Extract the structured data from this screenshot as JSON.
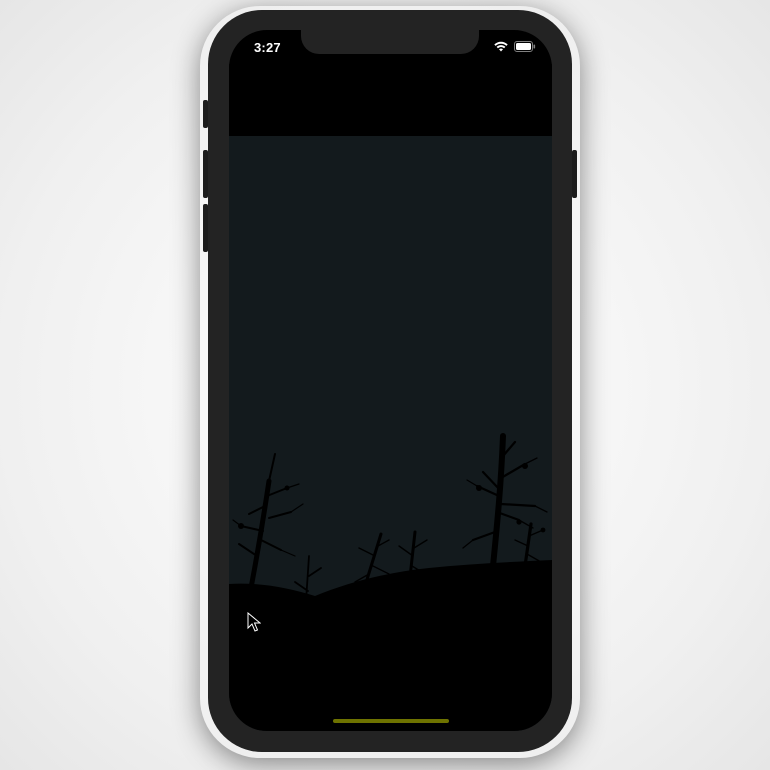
{
  "status_bar": {
    "time": "3:27",
    "wifi_icon": "wifi-icon",
    "battery_icon": "battery-icon"
  },
  "scene": {
    "description_icon": "forest-silhouette-illustration",
    "sky_color": "#131a1d",
    "ground_color": "#000000"
  },
  "home_indicator": {
    "color": "#6e7300"
  },
  "cursor": {
    "icon": "mouse-pointer-icon"
  }
}
